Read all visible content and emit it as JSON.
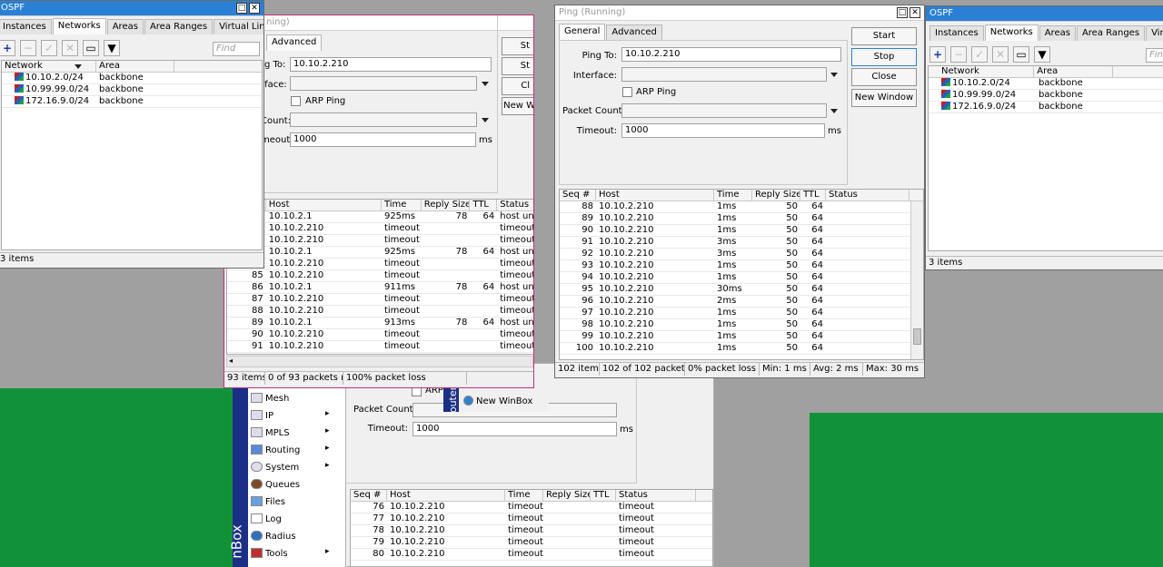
{
  "bg": {
    "green": "#129238",
    "gray": "#a0a0a0"
  },
  "ospf": {
    "title": "OSPF",
    "tabs": [
      "Instances",
      "Networks",
      "Areas",
      "Area Ranges",
      "Virtual Links",
      "..."
    ],
    "find_placeholder": "Find",
    "columns": [
      "Network",
      "Area"
    ],
    "rows": [
      {
        "network": "10.10.2.0/24",
        "area": "backbone"
      },
      {
        "network": "10.99.99.0/24",
        "area": "backbone"
      },
      {
        "network": "172.16.9.0/24",
        "area": "backbone"
      }
    ],
    "status": "3 items"
  },
  "ping_common": {
    "labels": {
      "ping_to": "Ping To:",
      "interface": "Interface:",
      "arp": "ARP Ping",
      "packet_count": "Packet Count:",
      "timeout": "Timeout:",
      "ms": "ms"
    },
    "tab_general": "General",
    "tab_advanced": "Advanced",
    "buttons": {
      "start": "Start",
      "stop": "Stop",
      "close": "Close",
      "new_window": "New Window"
    },
    "ping_to_value": "10.10.2.210",
    "timeout_value": "1000"
  },
  "ping_left": {
    "title_fragment": "ning)",
    "labels": {
      "ping_to": "g To:",
      "interface": "rface:",
      "count": "Count:",
      "timeout": "meout:"
    },
    "buttons_frag": {
      "start": "St",
      "stop": "St",
      "close": "Cl",
      "new": "New W"
    },
    "columns": [
      "Host",
      "Time",
      "Reply Size",
      "TTL",
      "Status"
    ],
    "rows": [
      {
        "seq": "",
        "host": "10.10.2.1",
        "time": "925ms",
        "size": "78",
        "ttl": "64",
        "status": "host unre"
      },
      {
        "seq": "",
        "host": "10.10.2.210",
        "time": "timeout",
        "size": "",
        "ttl": "",
        "status": "timeout"
      },
      {
        "seq": "",
        "host": "10.10.2.210",
        "time": "timeout",
        "size": "",
        "ttl": "",
        "status": "timeout"
      },
      {
        "seq": "",
        "host": "10.10.2.1",
        "time": "925ms",
        "size": "78",
        "ttl": "64",
        "status": "host unre"
      },
      {
        "seq": "",
        "host": "10.10.2.210",
        "time": "timeout",
        "size": "",
        "ttl": "",
        "status": "timeout"
      },
      {
        "seq": "85",
        "host": "10.10.2.210",
        "time": "timeout",
        "size": "",
        "ttl": "",
        "status": "timeout"
      },
      {
        "seq": "86",
        "host": "10.10.2.1",
        "time": "911ms",
        "size": "78",
        "ttl": "64",
        "status": "host unre"
      },
      {
        "seq": "87",
        "host": "10.10.2.210",
        "time": "timeout",
        "size": "",
        "ttl": "",
        "status": "timeout"
      },
      {
        "seq": "88",
        "host": "10.10.2.210",
        "time": "timeout",
        "size": "",
        "ttl": "",
        "status": "timeout"
      },
      {
        "seq": "89",
        "host": "10.10.2.1",
        "time": "913ms",
        "size": "78",
        "ttl": "64",
        "status": "host unre"
      },
      {
        "seq": "90",
        "host": "10.10.2.210",
        "time": "timeout",
        "size": "",
        "ttl": "",
        "status": "timeout"
      },
      {
        "seq": "91",
        "host": "10.10.2.210",
        "time": "timeout",
        "size": "",
        "ttl": "",
        "status": "timeout"
      }
    ],
    "status": [
      "93 items",
      "0 of 93 packets re...",
      "100% packet loss"
    ]
  },
  "ping_main": {
    "title": "Ping (Running)",
    "columns": [
      "Seq #",
      "Host",
      "Time",
      "Reply Size",
      "TTL",
      "Status"
    ],
    "rows": [
      {
        "seq": "88",
        "host": "10.10.2.210",
        "time": "1ms",
        "size": "50",
        "ttl": "64"
      },
      {
        "seq": "89",
        "host": "10.10.2.210",
        "time": "1ms",
        "size": "50",
        "ttl": "64"
      },
      {
        "seq": "90",
        "host": "10.10.2.210",
        "time": "1ms",
        "size": "50",
        "ttl": "64"
      },
      {
        "seq": "91",
        "host": "10.10.2.210",
        "time": "3ms",
        "size": "50",
        "ttl": "64"
      },
      {
        "seq": "92",
        "host": "10.10.2.210",
        "time": "3ms",
        "size": "50",
        "ttl": "64"
      },
      {
        "seq": "93",
        "host": "10.10.2.210",
        "time": "1ms",
        "size": "50",
        "ttl": "64"
      },
      {
        "seq": "94",
        "host": "10.10.2.210",
        "time": "1ms",
        "size": "50",
        "ttl": "64"
      },
      {
        "seq": "95",
        "host": "10.10.2.210",
        "time": "30ms",
        "size": "50",
        "ttl": "64"
      },
      {
        "seq": "96",
        "host": "10.10.2.210",
        "time": "2ms",
        "size": "50",
        "ttl": "64"
      },
      {
        "seq": "97",
        "host": "10.10.2.210",
        "time": "1ms",
        "size": "50",
        "ttl": "64"
      },
      {
        "seq": "98",
        "host": "10.10.2.210",
        "time": "1ms",
        "size": "50",
        "ttl": "64"
      },
      {
        "seq": "99",
        "host": "10.10.2.210",
        "time": "1ms",
        "size": "50",
        "ttl": "64"
      },
      {
        "seq": "100",
        "host": "10.10.2.210",
        "time": "1ms",
        "size": "50",
        "ttl": "64"
      }
    ],
    "status": [
      "102 items",
      "102 of 102 packets...",
      "0% packet loss",
      "Min: 1 ms",
      "Avg: 2 ms",
      "Max: 30 ms"
    ]
  },
  "ping_bottom": {
    "arp_frag": "ARP",
    "new_winbox": "New WinBox",
    "rows": [
      {
        "seq": "76",
        "host": "10.10.2.210",
        "time": "timeout",
        "status": "timeout"
      },
      {
        "seq": "77",
        "host": "10.10.2.210",
        "time": "timeout",
        "status": "timeout"
      },
      {
        "seq": "78",
        "host": "10.10.2.210",
        "time": "timeout",
        "status": "timeout"
      },
      {
        "seq": "79",
        "host": "10.10.2.210",
        "time": "timeout",
        "status": "timeout"
      },
      {
        "seq": "80",
        "host": "10.10.2.210",
        "time": "timeout",
        "status": "timeout"
      }
    ]
  },
  "menu": {
    "brand": "nBox",
    "brand2": "outer",
    "items": [
      "Mesh",
      "IP",
      "MPLS",
      "Routing",
      "System",
      "Queues",
      "Files",
      "Log",
      "Radius",
      "Tools"
    ]
  }
}
